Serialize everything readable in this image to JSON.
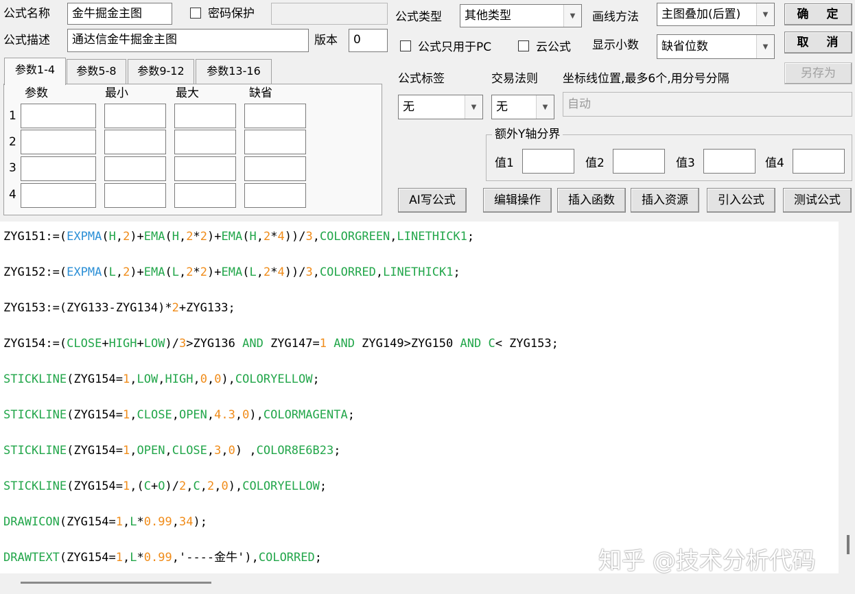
{
  "form": {
    "name_label": "公式名称",
    "name_value": "金牛掘金主图",
    "password_label": "密码保护",
    "password_checked": false,
    "password_value": "",
    "desc_label": "公式描述",
    "desc_value": "通达信金牛掘金主图",
    "version_label": "版本",
    "version_value": "0"
  },
  "tabs": [
    {
      "label": "参数1-4",
      "active": true
    },
    {
      "label": "参数5-8",
      "active": false
    },
    {
      "label": "参数9-12",
      "active": false
    },
    {
      "label": "参数13-16",
      "active": false
    }
  ],
  "params": {
    "headers": [
      "参数",
      "最小",
      "最大",
      "缺省"
    ],
    "rows": [
      {
        "num": "1",
        "values": [
          "",
          "",
          "",
          ""
        ]
      },
      {
        "num": "2",
        "values": [
          "",
          "",
          "",
          ""
        ]
      },
      {
        "num": "3",
        "values": [
          "",
          "",
          "",
          ""
        ]
      },
      {
        "num": "4",
        "values": [
          "",
          "",
          "",
          ""
        ]
      }
    ]
  },
  "settings": {
    "type_label": "公式类型",
    "type_value": "其他类型",
    "draw_label": "画线方法",
    "draw_value": "主图叠加(后置)",
    "pc_only_label": "公式只用于PC",
    "cloud_label": "云公式",
    "decimal_label": "显示小数",
    "decimal_value": "缺省位数",
    "tag_label": "公式标签",
    "tag_value": "无",
    "rule_label": "交易法则",
    "rule_value": "无",
    "coord_label": "坐标线位置,最多6个,用分号分隔",
    "coord_value": "自动",
    "yaxis_title": "额外Y轴分界",
    "y_labels": [
      "值1",
      "值2",
      "值3",
      "值4"
    ]
  },
  "buttons": {
    "ok": "确 定",
    "cancel": "取 消",
    "save_as": "另存为",
    "ai": "AI写公式",
    "edit": "编辑操作",
    "insert_func": "插入函数",
    "insert_res": "插入资源",
    "import": "引入公式",
    "test": "测试公式"
  },
  "code": {
    "lines": [
      "ZYG151:=(EXPMA(H,2)+EMA(H,2*2)+EMA(H,2*4))/3,COLORGREEN,LINETHICK1;",
      "ZYG152:=(EXPMA(L,2)+EMA(L,2*2)+EMA(L,2*4))/3,COLORRED,LINETHICK1;",
      "ZYG153:=(ZYG133-ZYG134)*2+ZYG133;",
      "ZYG154:=(CLOSE+HIGH+LOW)/3>ZYG136 AND ZYG147=1 AND ZYG149>ZYG150 AND C< ZYG153;",
      "STICKLINE(ZYG154=1,LOW,HIGH,0,0),COLORYELLOW;",
      "STICKLINE(ZYG154=1,CLOSE,OPEN,4.3,0),COLORMAGENTA;",
      "STICKLINE(ZYG154=1,OPEN,CLOSE,3,0) ,COLOR8E6B23;",
      "STICKLINE(ZYG154=1,(C+O)/2,C,2,0),COLORYELLOW;",
      "DRAWICON(ZYG154=1,L*0.99,34);",
      "DRAWTEXT(ZYG154=1,L*0.99,'----金牛'),COLORRED;"
    ]
  },
  "watermark": "知乎 @技术分析代码",
  "colors": {
    "keyword": "#22a64a",
    "function": "#2b8fd6",
    "number": "#f08c1a"
  }
}
